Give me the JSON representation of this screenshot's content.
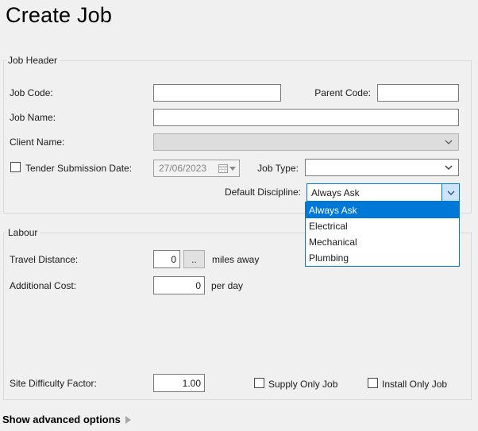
{
  "page": {
    "title": "Create Job"
  },
  "colors": {
    "accent": "#0078d7",
    "selected_item_bg": "#0078d7",
    "selected_item_text": "#ffffff",
    "combo_open_button_bg": "#cce4f7",
    "disabled_field_bg": "#dddddd",
    "background": "#f0f0f0"
  },
  "job_header": {
    "legend": "Job Header",
    "job_code_label": "Job Code:",
    "job_code_value": "",
    "parent_code_label": "Parent Code:",
    "parent_code_value": "",
    "job_name_label": "Job Name:",
    "job_name_value": "",
    "client_name_label": "Client Name:",
    "client_name_value": "",
    "tender_label": "Tender Submission Date:",
    "tender_checked": false,
    "tender_date_value": "27/06/2023",
    "job_type_label": "Job Type:",
    "job_type_value": "",
    "default_discipline_label": "Default Discipline:",
    "default_discipline_value": "Always Ask",
    "discipline_options": [
      "Always Ask",
      "Electrical",
      "Mechanical",
      "Plumbing"
    ],
    "discipline_selected_index": 0
  },
  "labour": {
    "legend": "Labour",
    "travel_distance_label": "Travel Distance:",
    "travel_distance_value": "0",
    "browse_button_label": "..",
    "travel_distance_suffix": "miles away",
    "additional_cost_label": "Additional Cost:",
    "additional_cost_value": "0",
    "additional_cost_suffix": "per day",
    "site_difficulty_label": "Site Difficulty Factor:",
    "site_difficulty_value": "1.00",
    "supply_only_label": "Supply Only Job",
    "supply_only_checked": false,
    "install_only_label": "Install Only Job",
    "install_only_checked": false
  },
  "footer": {
    "advanced_link_label": "Show advanced options"
  }
}
